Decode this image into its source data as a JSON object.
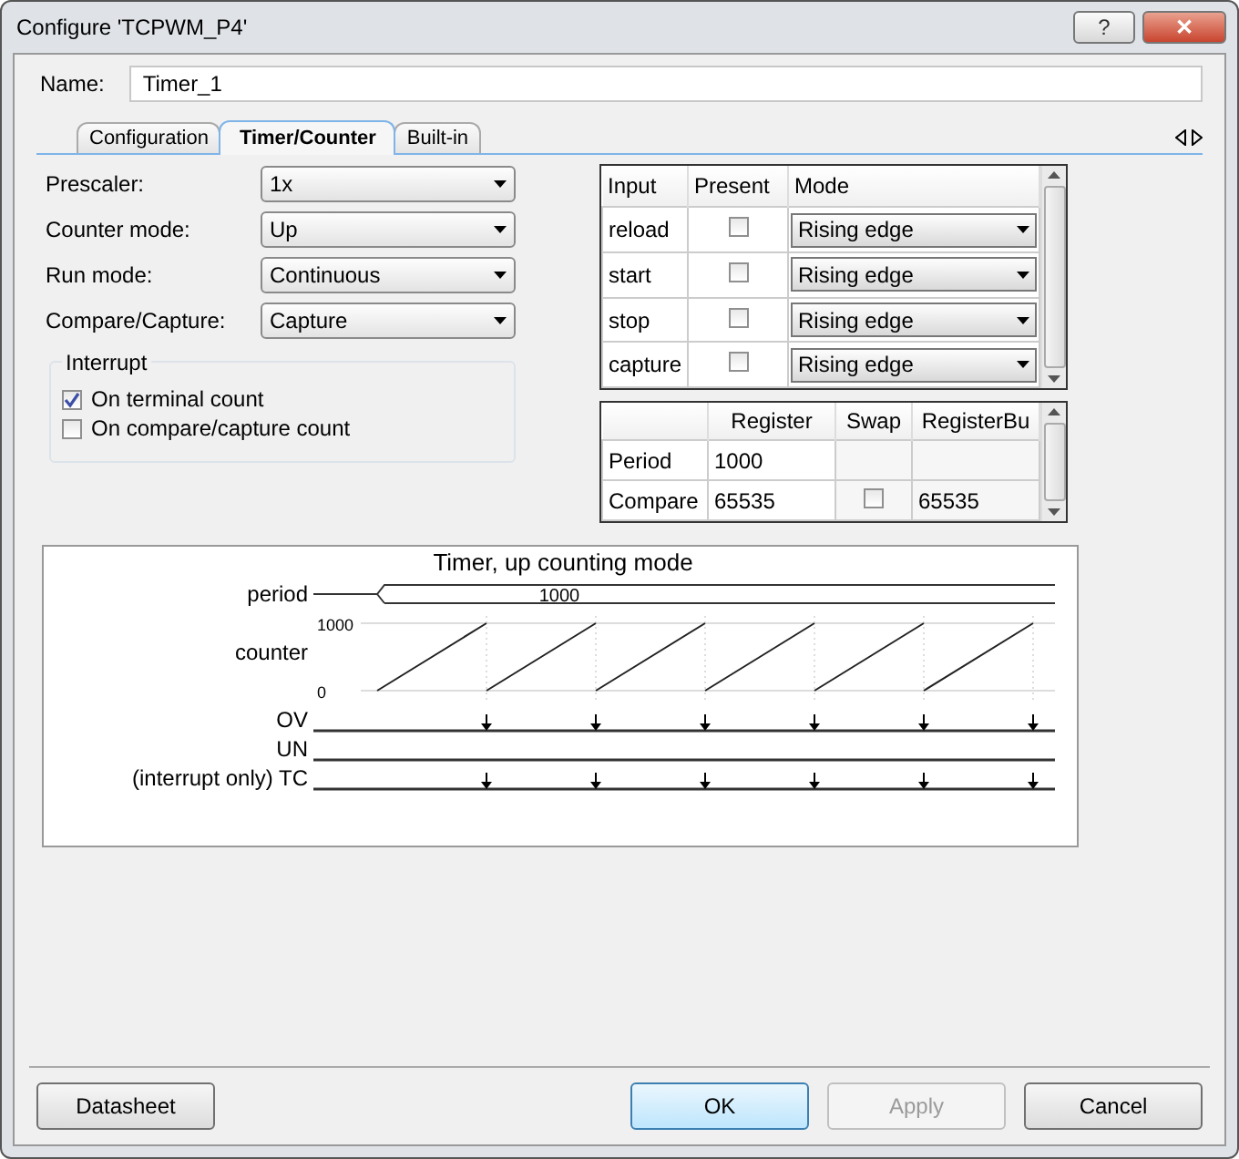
{
  "window": {
    "title": "Configure 'TCPWM_P4'",
    "help": "?",
    "close": "✕"
  },
  "name": {
    "label": "Name:",
    "value": "Timer_1"
  },
  "tabs": [
    {
      "label": "Configuration",
      "selected": false
    },
    {
      "label": "Timer/Counter",
      "selected": true
    },
    {
      "label": "Built-in",
      "selected": false
    }
  ],
  "fields": [
    {
      "label": "Prescaler:",
      "value": "1x"
    },
    {
      "label": "Counter mode:",
      "value": "Up"
    },
    {
      "label": "Run mode:",
      "value": "Continuous"
    },
    {
      "label": "Compare/Capture:",
      "value": "Capture"
    }
  ],
  "interrupt": {
    "title": "Interrupt",
    "options": [
      {
        "label": "On terminal count",
        "checked": true
      },
      {
        "label": "On compare/capture count",
        "checked": false
      }
    ]
  },
  "inputs_table": {
    "columns": [
      "Input",
      "Present",
      "Mode"
    ],
    "rows": [
      {
        "input": "reload",
        "present": false,
        "mode": "Rising edge"
      },
      {
        "input": "start",
        "present": false,
        "mode": "Rising edge"
      },
      {
        "input": "stop",
        "present": false,
        "mode": "Rising edge"
      },
      {
        "input": "capture",
        "present": false,
        "mode": "Rising edge"
      }
    ]
  },
  "register_table": {
    "columns": [
      "Register",
      "Swap",
      "RegisterBu"
    ],
    "rows": [
      {
        "name": "Period",
        "register": "1000",
        "buffer": ""
      },
      {
        "name": "Compare",
        "register": "65535",
        "swap": false,
        "buffer": "65535"
      }
    ]
  },
  "diagram": {
    "title": "Timer, up counting mode",
    "period_label": "period",
    "period_value": "1000",
    "counter_label": "counter",
    "counter_max": "1000",
    "counter_min": "0",
    "signals": [
      {
        "label": "OV",
        "pulses": true
      },
      {
        "label": "UN",
        "pulses": false
      },
      {
        "label": "(interrupt only) TC",
        "pulses": true
      }
    ]
  },
  "buttons": [
    {
      "label": "Datasheet",
      "default": false,
      "disabled": false
    },
    {
      "label": "OK",
      "default": true,
      "disabled": false
    },
    {
      "label": "Apply",
      "default": false,
      "disabled": true
    },
    {
      "label": "Cancel",
      "default": false,
      "disabled": false
    }
  ]
}
